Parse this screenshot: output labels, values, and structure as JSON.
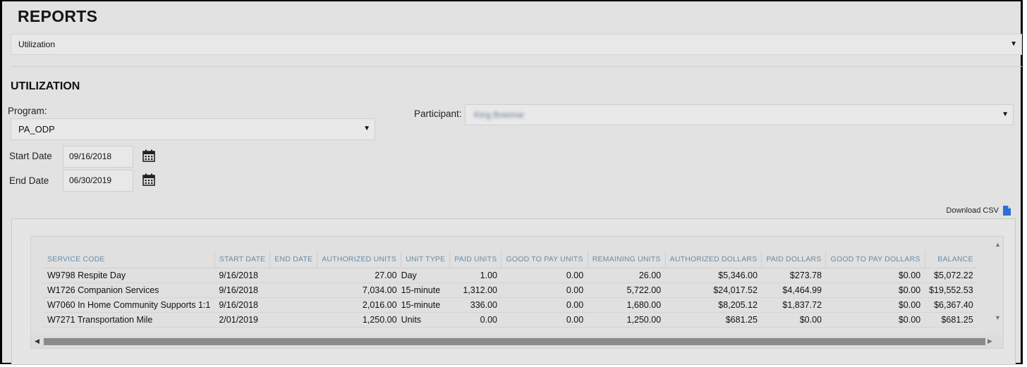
{
  "header": {
    "title": "REPORTS"
  },
  "report_select": {
    "value": "Utilization"
  },
  "section": {
    "title": "UTILIZATION"
  },
  "program": {
    "label": "Program:",
    "value": "PA_ODP"
  },
  "participant": {
    "label": "Participant:",
    "value": "King Bowmar"
  },
  "start_date": {
    "label": "Start Date",
    "value": "09/16/2018"
  },
  "end_date": {
    "label": "End Date",
    "value": "06/30/2019"
  },
  "download": {
    "label": "Download CSV"
  },
  "table": {
    "columns": [
      "SERVICE CODE",
      "START DATE",
      "END DATE",
      "AUTHORIZED UNITS",
      "UNIT TYPE",
      "PAID UNITS",
      "GOOD TO PAY UNITS",
      "REMAINING UNITS",
      "AUTHORIZED DOLLARS",
      "PAID DOLLARS",
      "GOOD TO PAY DOLLARS",
      "BALANCE"
    ],
    "rows": [
      [
        "W9798 Respite Day",
        "9/16/2018",
        "",
        "27.00",
        "Day",
        "1.00",
        "0.00",
        "26.00",
        "$5,346.00",
        "$273.78",
        "$0.00",
        "$5,072.22"
      ],
      [
        "W1726 Companion Services",
        "9/16/2018",
        "",
        "7,034.00",
        "15-minute",
        "1,312.00",
        "0.00",
        "5,722.00",
        "$24,017.52",
        "$4,464.99",
        "$0.00",
        "$19,552.53"
      ],
      [
        "W7060 In Home Community Supports 1:1",
        "9/16/2018",
        "",
        "2,016.00",
        "15-minute",
        "336.00",
        "0.00",
        "1,680.00",
        "$8,205.12",
        "$1,837.72",
        "$0.00",
        "$6,367.40"
      ],
      [
        "W7271 Transportation Mile",
        "2/01/2019",
        "",
        "1,250.00",
        "Units",
        "0.00",
        "0.00",
        "1,250.00",
        "$681.25",
        "$0.00",
        "$0.00",
        "$681.25"
      ]
    ]
  }
}
